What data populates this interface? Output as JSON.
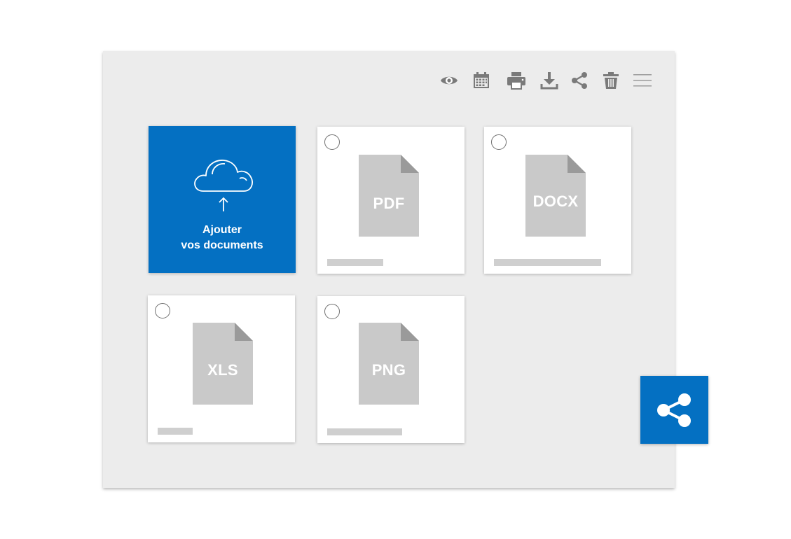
{
  "toolbar": {
    "icons": [
      "eye-icon",
      "calendar-icon",
      "printer-icon",
      "download-icon",
      "share-icon",
      "trash-icon",
      "menu-icon"
    ],
    "icon_color": "#7a7a7a"
  },
  "upload": {
    "line1": "Ajouter",
    "line2": "vos documents",
    "icon": "cloud-upload-icon",
    "color": "#0470c2"
  },
  "files": [
    {
      "type": "PDF"
    },
    {
      "type": "DOCX"
    },
    {
      "type": "XLS"
    },
    {
      "type": "PNG"
    }
  ],
  "fab": {
    "icon": "share-icon",
    "color": "#0470c2"
  }
}
